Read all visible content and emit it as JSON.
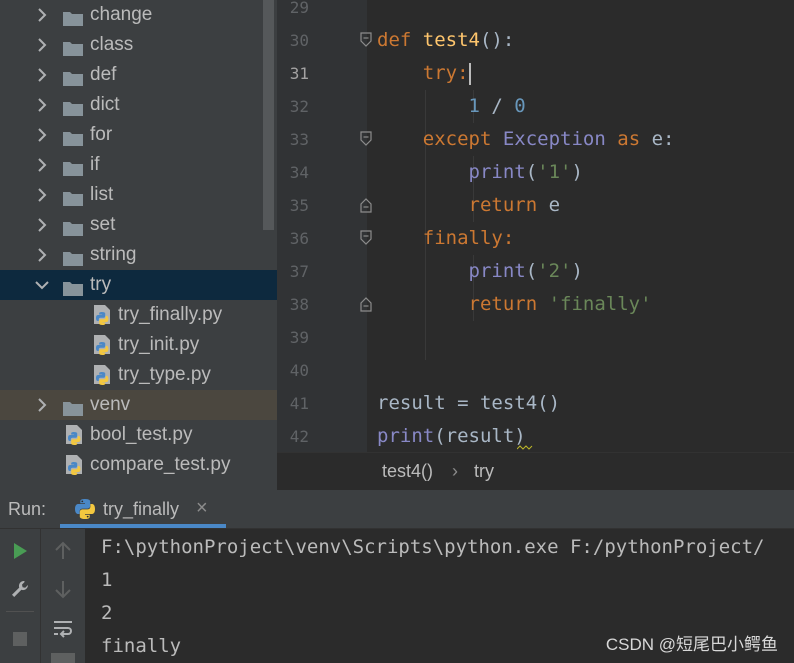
{
  "project_tree": {
    "items": [
      {
        "label": "change",
        "type": "folder",
        "expanded": false
      },
      {
        "label": "class",
        "type": "folder",
        "expanded": false
      },
      {
        "label": "def",
        "type": "folder",
        "expanded": false
      },
      {
        "label": "dict",
        "type": "folder",
        "expanded": false
      },
      {
        "label": "for",
        "type": "folder",
        "expanded": false
      },
      {
        "label": "if",
        "type": "folder",
        "expanded": false
      },
      {
        "label": "list",
        "type": "folder",
        "expanded": false
      },
      {
        "label": "set",
        "type": "folder",
        "expanded": false
      },
      {
        "label": "string",
        "type": "folder",
        "expanded": false
      },
      {
        "label": "try",
        "type": "folder",
        "expanded": true,
        "selected": true
      },
      {
        "label": "try_finally.py",
        "type": "python-file"
      },
      {
        "label": "try_init.py",
        "type": "python-file"
      },
      {
        "label": "try_type.py",
        "type": "python-file"
      },
      {
        "label": "venv",
        "type": "folder",
        "expanded": false
      },
      {
        "label": "bool_test.py",
        "type": "python-file"
      },
      {
        "label": "compare_test.py",
        "type": "python-file"
      }
    ]
  },
  "editor": {
    "current_line": "31",
    "line_numbers": [
      "29",
      "30",
      "31",
      "32",
      "33",
      "34",
      "35",
      "36",
      "37",
      "38",
      "39",
      "40",
      "41",
      "42"
    ],
    "code": {
      "l30_def": "def",
      "l30_name": "test4",
      "l30_rest": "():",
      "l31_try": "try",
      "l31_colon": ":",
      "l32_num1": "1",
      "l32_op": " / ",
      "l32_num2": "0",
      "l33_except": "except",
      "l33_exc": "Exception",
      "l33_as": "as",
      "l33_rest": "e:",
      "l34_print": "print",
      "l34_open": "(",
      "l34_str": "'1'",
      "l34_close": ")",
      "l35_return": "return",
      "l35_rest": "e",
      "l36_finally": "finally",
      "l36_colon": ":",
      "l37_print": "print",
      "l37_open": "(",
      "l37_str": "'2'",
      "l37_close": ")",
      "l38_return": "return",
      "l38_str": "'finally'",
      "l41": "result = test4()",
      "l42_print": "print",
      "l42_rest": "(result)"
    },
    "breadcrumb": {
      "function": "test4()",
      "separator": "›",
      "block": "try"
    }
  },
  "run_panel": {
    "label": "Run:",
    "tab_label": "try_finally",
    "close_glyph": "×",
    "output": [
      "F:\\pythonProject\\venv\\Scripts\\python.exe F:/pythonProject/",
      "1",
      "2",
      "finally"
    ]
  },
  "watermark": "CSDN @短尾巴小鳄鱼",
  "colors": {
    "selection": "#0d293e",
    "keyword": "#cc7832",
    "function_name": "#ffc66d",
    "builtin": "#8888c6",
    "number": "#6897bb",
    "string": "#6a8759",
    "run_green": "#499c54"
  }
}
